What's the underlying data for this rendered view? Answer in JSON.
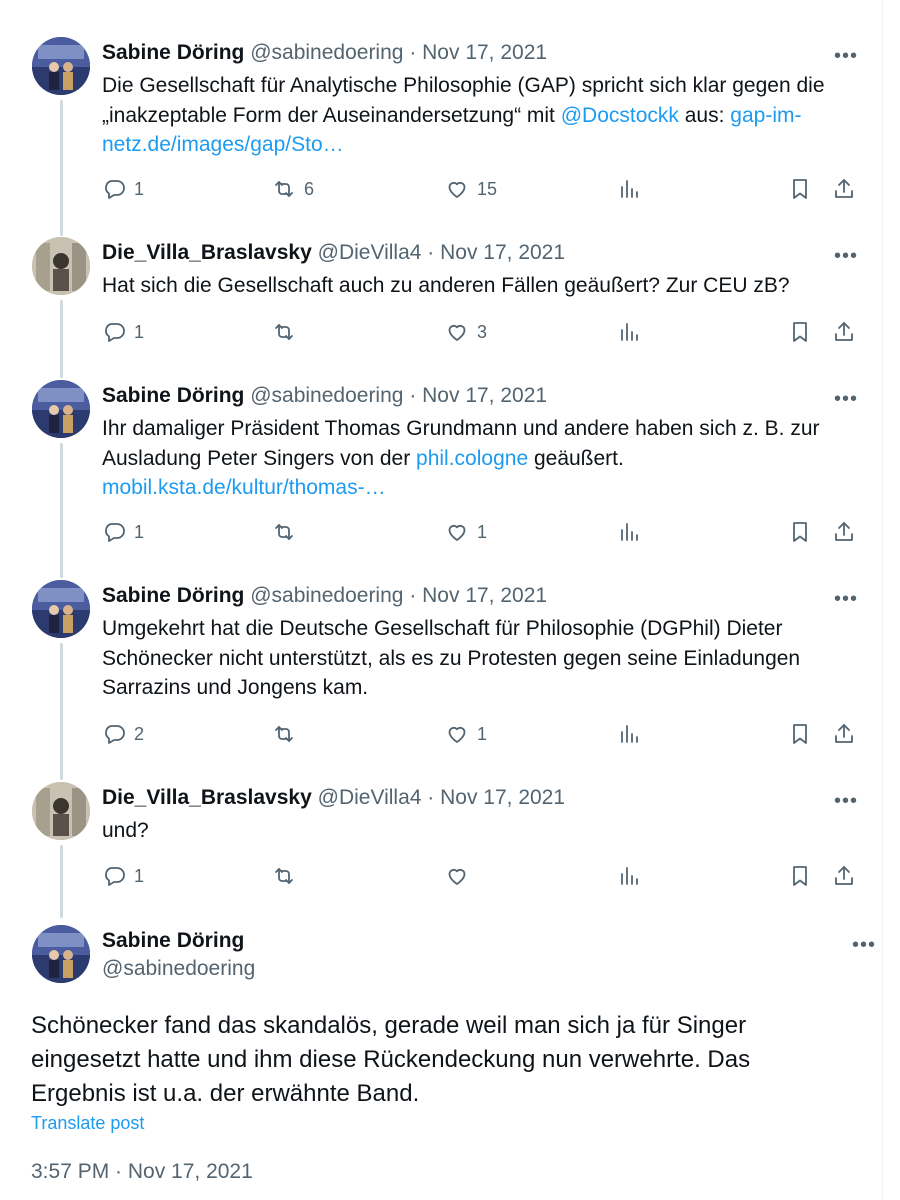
{
  "replies": [
    {
      "name": "Sabine Döring",
      "handle": "@sabinedoering",
      "date": "· Nov 17, 2021",
      "avatar": "sabine",
      "segments": [
        {
          "t": "Die Gesellschaft für Analytische Philosophie (GAP) spricht sich klar gegen die „inakzeptable Form der Auseinandersetzung“ mit "
        },
        {
          "t": "@Docstockk",
          "link": true
        },
        {
          "t": " aus: "
        },
        {
          "t": "gap-im-netz.de/images/gap/Sto…",
          "link": true
        }
      ],
      "stats": {
        "replies": "1",
        "reposts": "6",
        "likes": "15"
      }
    },
    {
      "name": "Die_Villa_Braslavsky",
      "handle": "@DieVilla4",
      "date": "· Nov 17, 2021",
      "avatar": "villa",
      "segments": [
        {
          "t": "Hat sich die Gesellschaft auch zu anderen Fällen geäußert? Zur CEU zB?"
        }
      ],
      "stats": {
        "replies": "1",
        "reposts": "",
        "likes": "3"
      }
    },
    {
      "name": "Sabine Döring",
      "handle": "@sabinedoering",
      "date": "· Nov 17, 2021",
      "avatar": "sabine",
      "segments": [
        {
          "t": "Ihr damaliger Präsident Thomas Grundmann und andere haben sich z. B. zur Ausladung Peter Singers von der "
        },
        {
          "t": "phil.cologne",
          "link": true
        },
        {
          "t": " geäußert. "
        },
        {
          "t": "mobil.ksta.de/kultur/thomas-…",
          "link": true
        }
      ],
      "stats": {
        "replies": "1",
        "reposts": "",
        "likes": "1"
      }
    },
    {
      "name": "Sabine Döring",
      "handle": "@sabinedoering",
      "date": "· Nov 17, 2021",
      "avatar": "sabine",
      "segments": [
        {
          "t": "Umgekehrt hat die Deutsche Gesellschaft für Philosophie (DGPhil) Dieter Schönecker nicht unterstützt, als es zu Protesten gegen seine Einladungen Sarrazins und Jongens kam."
        }
      ],
      "stats": {
        "replies": "2",
        "reposts": "",
        "likes": "1"
      }
    },
    {
      "name": "Die_Villa_Braslavsky",
      "handle": "@DieVilla4",
      "date": "· Nov 17, 2021",
      "avatar": "villa",
      "segments": [
        {
          "t": "und?"
        }
      ],
      "stats": {
        "replies": "1",
        "reposts": "",
        "likes": ""
      }
    }
  ],
  "main_post": {
    "name": "Sabine Döring",
    "handle": "@sabinedoering",
    "text": "Schönecker fand das skandalös, gerade weil man sich ja für Singer eingesetzt hatte und ihm diese Rückendeckung nun verwehrte. Das Ergebnis ist u.a. der erwähnte Band.",
    "translate_label": "Translate post",
    "timestamp": "3:57 PM · Nov 17, 2021"
  },
  "icons": {
    "reply": "reply-icon",
    "repost": "repost-icon",
    "like": "heart-icon",
    "views": "analytics-icon",
    "bookmark": "bookmark-icon",
    "share": "share-icon",
    "more": "more-icon"
  },
  "colors": {
    "link": "#1d9bf0",
    "muted": "#536471",
    "text": "#0f1419",
    "thread_line": "#cfd9de"
  }
}
